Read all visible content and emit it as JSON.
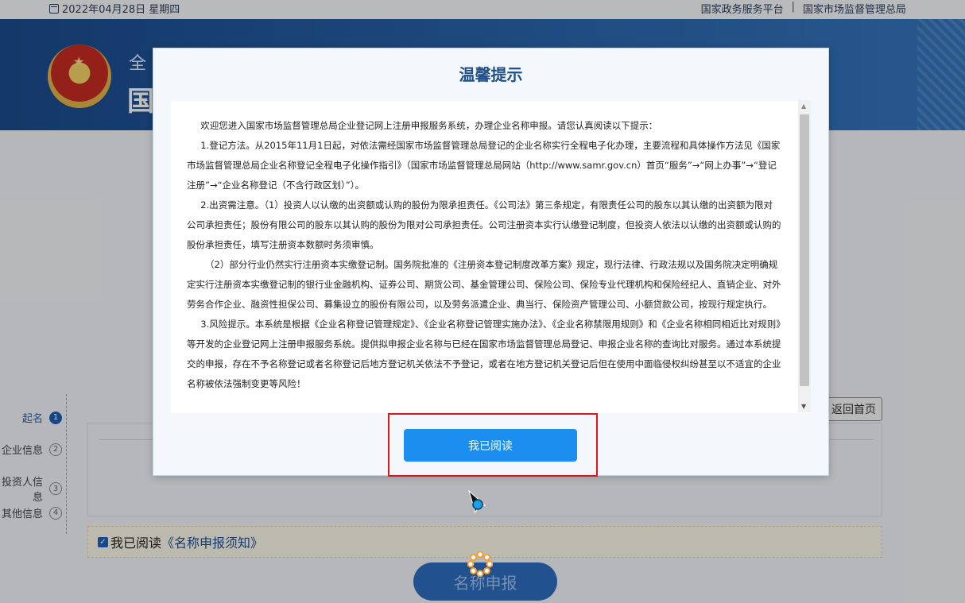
{
  "topbar": {
    "date": "2022年04月28日 星期四",
    "link1": "国家政务服务平台",
    "separator": "|",
    "link2": "国家市场监督管理总局"
  },
  "banner": {
    "subtitle_partial": "全",
    "title_partial": "国"
  },
  "steps": [
    {
      "label": "起名",
      "num": "1",
      "active": true
    },
    {
      "label": "企业信息",
      "num": "2",
      "active": false
    },
    {
      "label": "投资人信息",
      "num": "3",
      "active": false
    },
    {
      "label": "其他信息",
      "num": "4",
      "active": false
    }
  ],
  "back_button": "返回首页",
  "agree": {
    "prefix": "我已阅读",
    "link": "《名称申报须知》"
  },
  "submit_button": "名称申报",
  "modal": {
    "title": "温馨提示",
    "paragraphs": [
      "欢迎您进入国家市场监督管理总局企业登记网上注册申报服务系统，办理企业名称申报。请您认真阅读以下提示：",
      "1.登记方法。从2015年11月1日起，对依法需经国家市场监督管理总局登记的企业名称实行全程电子化办理，主要流程和具体操作方法见《国家市场监督管理总局企业名称登记全程电子化操作指引》（国家市场监督管理总局网站（http://www.samr.gov.cn）首页“服务”→“网上办事”→“登记注册”→“企业名称登记（不含行政区划）”）。",
      "2.出资需注意。（1）投资人以认缴的出资额或认购的股份为限承担责任。《公司法》第三条规定，有限责任公司的股东以其认缴的出资额为限对公司承担责任；股份有限公司的股东以其认购的股份为限对公司承担责任。公司注册资本实行认缴登记制度，但投资人依法以认缴的出资额或认购的股份承担责任，填写注册资本数额时务须审慎。",
      "（2）部分行业仍然实行注册资本实缴登记制。国务院批准的《注册资本登记制度改革方案》规定，现行法律、行政法规以及国务院决定明确规定实行注册资本实缴登记制的银行业金融机构、证券公司、期货公司、基金管理公司、保险公司、保险专业代理机构和保险经纪人、直销企业、对外劳务合作企业、融资性担保公司、募集设立的股份有限公司，以及劳务派遣企业、典当行、保险资产管理公司、小额贷款公司，按现行规定执行。",
      "3.风险提示。本系统是根据《企业名称登记管理规定》、《企业名称登记管理实施办法》、《企业名称禁限用规则》和《企业名称相同相近比对规则》等开发的企业登记网上注册申报服务系统。提供拟申报企业名称与已经在国家市场监督管理总局登记、申报企业名称的查询比对服务。通过本系统提交的申报，存在不予名称登记或者名称登记后地方登记机关依法不予登记，或者在地方登记机关登记后但在使用中面临侵权纠纷甚至以不适宜的企业名称被依法强制变更等风险！"
    ],
    "confirm_button": "我已阅读"
  },
  "colors": {
    "primary_button": "#1c8ef0",
    "highlight": "#e5141b",
    "title": "#1e4f8a"
  }
}
